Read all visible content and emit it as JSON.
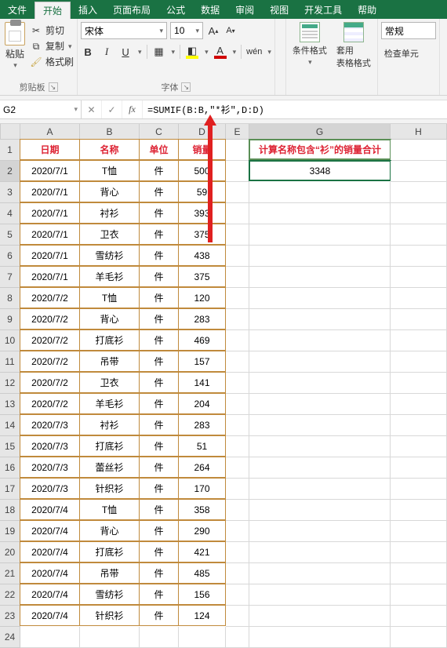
{
  "menu": {
    "file": "文件",
    "home": "开始",
    "insert": "插入",
    "layout": "页面布局",
    "formulas": "公式",
    "data": "数据",
    "review": "审阅",
    "view": "视图",
    "developer": "开发工具",
    "help": "帮助"
  },
  "ribbon": {
    "paste_label": "粘贴",
    "cut_label": "剪切",
    "copy_label": "复制",
    "format_painter": "格式刷",
    "clipboard_group": "剪贴板",
    "font_group": "字体",
    "font_name": "宋体",
    "font_size": "10",
    "wen_label": "wén",
    "number_group_value": "常规",
    "cond_format": "条件格式",
    "table_format": "套用\n表格格式",
    "check_cells": "检查单元"
  },
  "formula": {
    "cell_ref": "G2",
    "text": "=SUMIF(B:B,\"*衫\",D:D)"
  },
  "columns": [
    "A",
    "B",
    "C",
    "D",
    "E",
    "G",
    "H"
  ],
  "table": {
    "headers": {
      "date": "日期",
      "name": "名称",
      "unit": "单位",
      "sales": "销量"
    },
    "g_header": "计算名称包含“衫”的销量合计",
    "g_value": "3348",
    "rows": [
      {
        "r": 2,
        "date": "2020/7/1",
        "name": "T恤",
        "unit": "件",
        "sales": "500"
      },
      {
        "r": 3,
        "date": "2020/7/1",
        "name": "背心",
        "unit": "件",
        "sales": "59"
      },
      {
        "r": 4,
        "date": "2020/7/1",
        "name": "衬衫",
        "unit": "件",
        "sales": "393"
      },
      {
        "r": 5,
        "date": "2020/7/1",
        "name": "卫衣",
        "unit": "件",
        "sales": "375"
      },
      {
        "r": 6,
        "date": "2020/7/1",
        "name": "雪纺衫",
        "unit": "件",
        "sales": "438"
      },
      {
        "r": 7,
        "date": "2020/7/1",
        "name": "羊毛衫",
        "unit": "件",
        "sales": "375"
      },
      {
        "r": 8,
        "date": "2020/7/2",
        "name": "T恤",
        "unit": "件",
        "sales": "120"
      },
      {
        "r": 9,
        "date": "2020/7/2",
        "name": "背心",
        "unit": "件",
        "sales": "283"
      },
      {
        "r": 10,
        "date": "2020/7/2",
        "name": "打底衫",
        "unit": "件",
        "sales": "469"
      },
      {
        "r": 11,
        "date": "2020/7/2",
        "name": "吊带",
        "unit": "件",
        "sales": "157"
      },
      {
        "r": 12,
        "date": "2020/7/2",
        "name": "卫衣",
        "unit": "件",
        "sales": "141"
      },
      {
        "r": 13,
        "date": "2020/7/2",
        "name": "羊毛衫",
        "unit": "件",
        "sales": "204"
      },
      {
        "r": 14,
        "date": "2020/7/3",
        "name": "衬衫",
        "unit": "件",
        "sales": "283"
      },
      {
        "r": 15,
        "date": "2020/7/3",
        "name": "打底衫",
        "unit": "件",
        "sales": "51"
      },
      {
        "r": 16,
        "date": "2020/7/3",
        "name": "蕾丝衫",
        "unit": "件",
        "sales": "264"
      },
      {
        "r": 17,
        "date": "2020/7/3",
        "name": "针织衫",
        "unit": "件",
        "sales": "170"
      },
      {
        "r": 18,
        "date": "2020/7/4",
        "name": "T恤",
        "unit": "件",
        "sales": "358"
      },
      {
        "r": 19,
        "date": "2020/7/4",
        "name": "背心",
        "unit": "件",
        "sales": "290"
      },
      {
        "r": 20,
        "date": "2020/7/4",
        "name": "打底衫",
        "unit": "件",
        "sales": "421"
      },
      {
        "r": 21,
        "date": "2020/7/4",
        "name": "吊带",
        "unit": "件",
        "sales": "485"
      },
      {
        "r": 22,
        "date": "2020/7/4",
        "name": "雪纺衫",
        "unit": "件",
        "sales": "156"
      },
      {
        "r": 23,
        "date": "2020/7/4",
        "name": "针织衫",
        "unit": "件",
        "sales": "124"
      }
    ]
  }
}
